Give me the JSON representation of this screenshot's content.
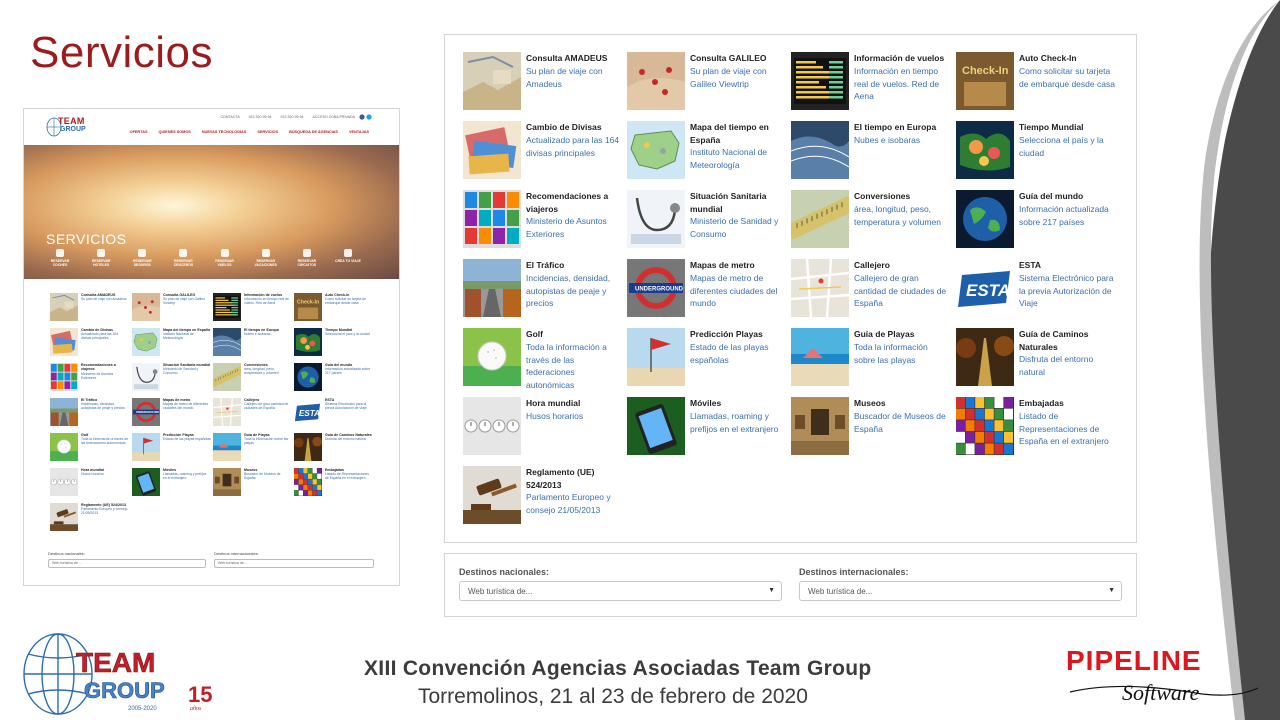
{
  "slide": {
    "title": "Servicios",
    "footer_title": "XIII Convención  Agencias Asociadas Team Group",
    "footer_subtitle": "Torremolinos, 21 al 23 de febrero de 2020",
    "title_color": "#9b1c1c"
  },
  "logos": {
    "team_group": {
      "word1": "TEAM",
      "word2": "GROUP",
      "years": "15",
      "years_word": "años",
      "range": "2005-2020"
    },
    "pipeline": {
      "word1": "PIPELINE",
      "word2": "Software"
    }
  },
  "mini_page": {
    "logo_team": "TEAM",
    "logo_group": "GROUP",
    "contact": [
      "CONTACTA",
      "913 320 99 94",
      "913 320 99 94",
      "ACCESO ZONA PRIVADA"
    ],
    "nav": [
      "OFERTAS",
      "QUIENES SOMOS",
      "NUEVAS TECNOLOGÍAS",
      "SERVICIOS",
      "BÚSQUEDA DE AGENCIAS",
      "VENTAJAS"
    ],
    "hero_title": "SERVICIOS",
    "hero_icons": [
      {
        "label": "RESERVAR COCHES"
      },
      {
        "label": "RESERVAR HOTELES"
      },
      {
        "label": "RESERVAR SEGUROS"
      },
      {
        "label": "RESERVAR CRUCEROS"
      },
      {
        "label": "RESERVAR VUELOS"
      },
      {
        "label": "RESERVAR VACACIONES"
      },
      {
        "label": "RESERVAR CIRCUITOS"
      },
      {
        "label": "CREA TU VIAJE"
      }
    ],
    "dest_nacionales_label": "Destinos nacionales:",
    "dest_internacionales_label": "Destinos internacionales:",
    "select_placeholder": "Web turística de..."
  },
  "services": [
    {
      "title": "Consulta AMADEUS",
      "subtitle": "Su plan de viaje con Amadeus",
      "icon": "map-thumbnail"
    },
    {
      "title": "Consulta GALILEO",
      "subtitle": "Su plan de viaje con Galileo Viewtrip",
      "icon": "map-pins-thumbnail"
    },
    {
      "title": "Información de vuelos",
      "subtitle": "Información en tiempo real de vuelos. Red de Aena",
      "icon": "departures-board-thumbnail"
    },
    {
      "title": "Auto Check-In",
      "subtitle": "Como solicitar su tarjeta de embarque desde casa",
      "icon": "check-in-thumbnail"
    },
    {
      "title": "Cambio de Divisas",
      "subtitle": "Actualizado para las 164 divisas principales",
      "icon": "banknotes-thumbnail"
    },
    {
      "title": "Mapa del tiempo en España",
      "subtitle": "Instituto Nacional de Meteorología",
      "icon": "weather-map-thumbnail"
    },
    {
      "title": "El tiempo en Europa",
      "subtitle": "Nubes e isobaras",
      "icon": "europe-weather-thumbnail"
    },
    {
      "title": "Tiempo Mundial",
      "subtitle": "Selecciona el país y la ciudad",
      "icon": "world-weather-thumbnail"
    },
    {
      "title": "Recomendaciones a viajeros",
      "subtitle": "Ministerio de Asuntos Exteriores",
      "icon": "travel-books-thumbnail"
    },
    {
      "title": "Situación Sanitaria mundial",
      "subtitle": "Ministerio de Sanidad y Consumo",
      "icon": "stethoscope-thumbnail"
    },
    {
      "title": "Conversiones",
      "subtitle": "área, longitud, peso, temperatura y volumen",
      "icon": "ruler-thumbnail"
    },
    {
      "title": "Guía del mundo",
      "subtitle": "Información actualizada sobre 217 países",
      "icon": "globe-thumbnail"
    },
    {
      "title": "El Tráfico",
      "subtitle": "Incidencias, densidad, autopistas de peaje y precios",
      "icon": "traffic-thumbnail"
    },
    {
      "title": "Mapas de metro",
      "subtitle": "Mapas de metro de diferentes ciudades del mundo",
      "icon": "underground-thumbnail"
    },
    {
      "title": "Callejero",
      "subtitle": "Callejero de gran cantidad de ciudades de España",
      "icon": "street-map-thumbnail"
    },
    {
      "title": "ESTA",
      "subtitle": "Sistema Electrónico para la previa Autorización de Viaje",
      "icon": "esta-logo-thumbnail"
    },
    {
      "title": "Golf",
      "subtitle": "Toda la información a través de las federaciones autonómicas",
      "icon": "golf-ball-thumbnail"
    },
    {
      "title": "Predicción Playas",
      "subtitle": "Estado de las playas españolas",
      "icon": "beach-flag-thumbnail"
    },
    {
      "title": "Guía de Playas",
      "subtitle": "Toda la información sobre las playas",
      "icon": "beach-thumbnail"
    },
    {
      "title": "Guía de Caminos Naturales",
      "subtitle": "Disfruta del entorno natural",
      "icon": "forest-path-thumbnail"
    },
    {
      "title": "Hora mundial",
      "subtitle": "Husos horarios",
      "icon": "clocks-thumbnail"
    },
    {
      "title": "Móviles",
      "subtitle": "Llamadas, roaming y prefijos en el extranjero",
      "icon": "mobile-phone-thumbnail"
    },
    {
      "title": "Museos",
      "subtitle": "Buscador de Museos de España",
      "icon": "museum-thumbnail"
    },
    {
      "title": "Embajadas",
      "subtitle": "Listado de Representaciones de España en el extranjero",
      "icon": "flags-thumbnail"
    },
    {
      "title": "Reglamento (UE) 524/2013",
      "subtitle": "Parlamento Europeo y consejo 21/05/2013",
      "icon": "gavel-thumbnail"
    }
  ],
  "destinos": {
    "nacionales_label": "Destinos nacionales:",
    "internacionales_label": "Destinos internacionales:",
    "nacionales_value": "Web turística de...",
    "internacionales_value": "Web turística de..."
  },
  "colors": {
    "link_blue": "#3a6fb0",
    "brand_red": "#b01c1c",
    "brand_blue": "#2b6cb0"
  }
}
